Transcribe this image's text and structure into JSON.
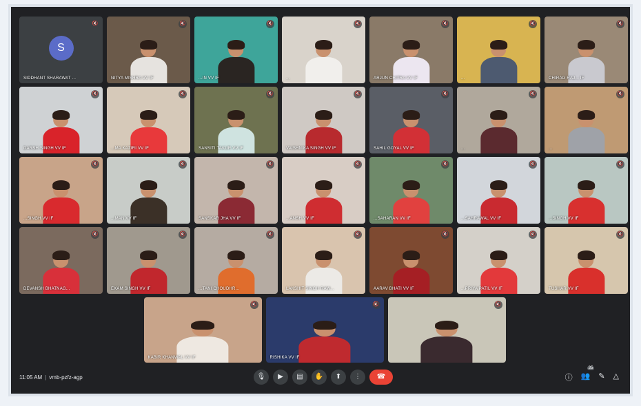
{
  "meeting": {
    "time": "11:05 AM",
    "separator": "|",
    "code": "vmb-pzfz-agp"
  },
  "participants_rows": [
    [
      {
        "name": "SIDDHANT SHARAWAT ...",
        "avatar_letter": "S",
        "avatar": true
      },
      {
        "name": "NITYA MISHRA VV IF",
        "bg": "#6b5a4a",
        "shirt": "#e6e3df"
      },
      {
        "name": "...IN VV IF",
        "bg": "#3ea59a",
        "shirt": "#2a2522"
      },
      {
        "name": "...",
        "bg": "#d9d3cb",
        "shirt": "#f1efec"
      },
      {
        "name": "ARJUN CHITRA VV IF",
        "bg": "#8a7a68",
        "shirt": "#ece6f0"
      },
      {
        "name": "...",
        "bg": "#d8b451",
        "shirt": "#4d5a70"
      },
      {
        "name": "CHIRAG RAJ... IF",
        "bg": "#9a8976",
        "shirt": "#c9c9cf"
      }
    ],
    [
      {
        "name": "DARSH SINGH VV IF",
        "bg": "#cfd2d4",
        "shirt": "#d9232a"
      },
      {
        "name": "...MA KAZIRI VV IF",
        "bg": "#d6c9b9",
        "shirt": "#e8393b"
      },
      {
        "name": "SANSITI TAKUR VV IF",
        "bg": "#6e7250",
        "shirt": "#cfe3e0"
      },
      {
        "name": "VAISHNIKA SINGH VV IF",
        "bg": "#cfc9c4",
        "shirt": "#b82a2e"
      },
      {
        "name": "SAHIL GOYAL VV IF",
        "bg": "#5a5e66",
        "shirt": "#d23036"
      },
      {
        "name": "...",
        "bg": "#b0a89c",
        "shirt": "#5b2a2f"
      },
      {
        "name": "...",
        "bg": "#bf9a73",
        "shirt": "#9fa2a8"
      }
    ],
    [
      {
        "name": "...SINGH VV IF",
        "bg": "#c8a489",
        "shirt": "#d92a2e"
      },
      {
        "name": "...MAN VV IF",
        "bg": "#c8ccc8",
        "shirt": "#3b3027"
      },
      {
        "name": "SANSKAR JHA VV IF",
        "bg": "#c3b6ac",
        "shirt": "#8b2a34"
      },
      {
        "name": "...ANSH VV IF",
        "bg": "#d8cdc5",
        "shirt": "#cf2d31"
      },
      {
        "name": "...SAHARAN VV IF",
        "bg": "#6f8a6a",
        "shirt": "#e1413f"
      },
      {
        "name": "...SAHRAWAL VV IF",
        "bg": "#d2d6db",
        "shirt": "#c92a30"
      },
      {
        "name": "...SINGH VV IF",
        "bg": "#b9c7c2",
        "shirt": "#d8302f"
      }
    ],
    [
      {
        "name": "DEVANSH BHATNAG...",
        "bg": "#7b6a5e",
        "shirt": "#d8303a"
      },
      {
        "name": "EKAM SINGH VV IF",
        "bg": "#a0998e",
        "shirt": "#c1272d"
      },
      {
        "name": "...TANI CHOUDHR...",
        "bg": "#b5aba2",
        "shirt": "#e06d2d"
      },
      {
        "name": "LAKSHIT SINGH RAW...",
        "bg": "#d9c4ae",
        "shirt": "#eceae6"
      },
      {
        "name": "AARAV BHATI VV IF",
        "bg": "#7e4a31",
        "shirt": "#a51f24"
      },
      {
        "name": "...PRIYA PATIL VV IF",
        "bg": "#d4d0c9",
        "shirt": "#e3393b"
      },
      {
        "name": "TUSHAR VV IF",
        "bg": "#d6c6ad",
        "shirt": "#d9302c"
      }
    ]
  ],
  "last_row": [
    {
      "name": "KABIR KHANWAL VV IF",
      "bg": "#c8a48a",
      "shirt": "#eee8e1"
    },
    {
      "name": "RISHIKA VV IF",
      "bg": "#2b3b6b",
      "shirt": "#bf2a2f"
    },
    {
      "name": "",
      "bg": "#c9c6b8",
      "shirt": "#3a2a2f"
    }
  ],
  "controls": {
    "mic_icon": "mic-icon",
    "camera_icon": "camera-icon",
    "captions_icon": "captions-icon",
    "raise_hand_icon": "raise-hand-icon",
    "present_icon": "present-icon",
    "more_icon": "more-options-icon",
    "end_call_icon": "end-call-icon"
  },
  "right_panel": {
    "people_count": "35"
  },
  "colors": {
    "background": "#202124",
    "end_call": "#ea4335",
    "avatar": "#5b6cc8"
  }
}
